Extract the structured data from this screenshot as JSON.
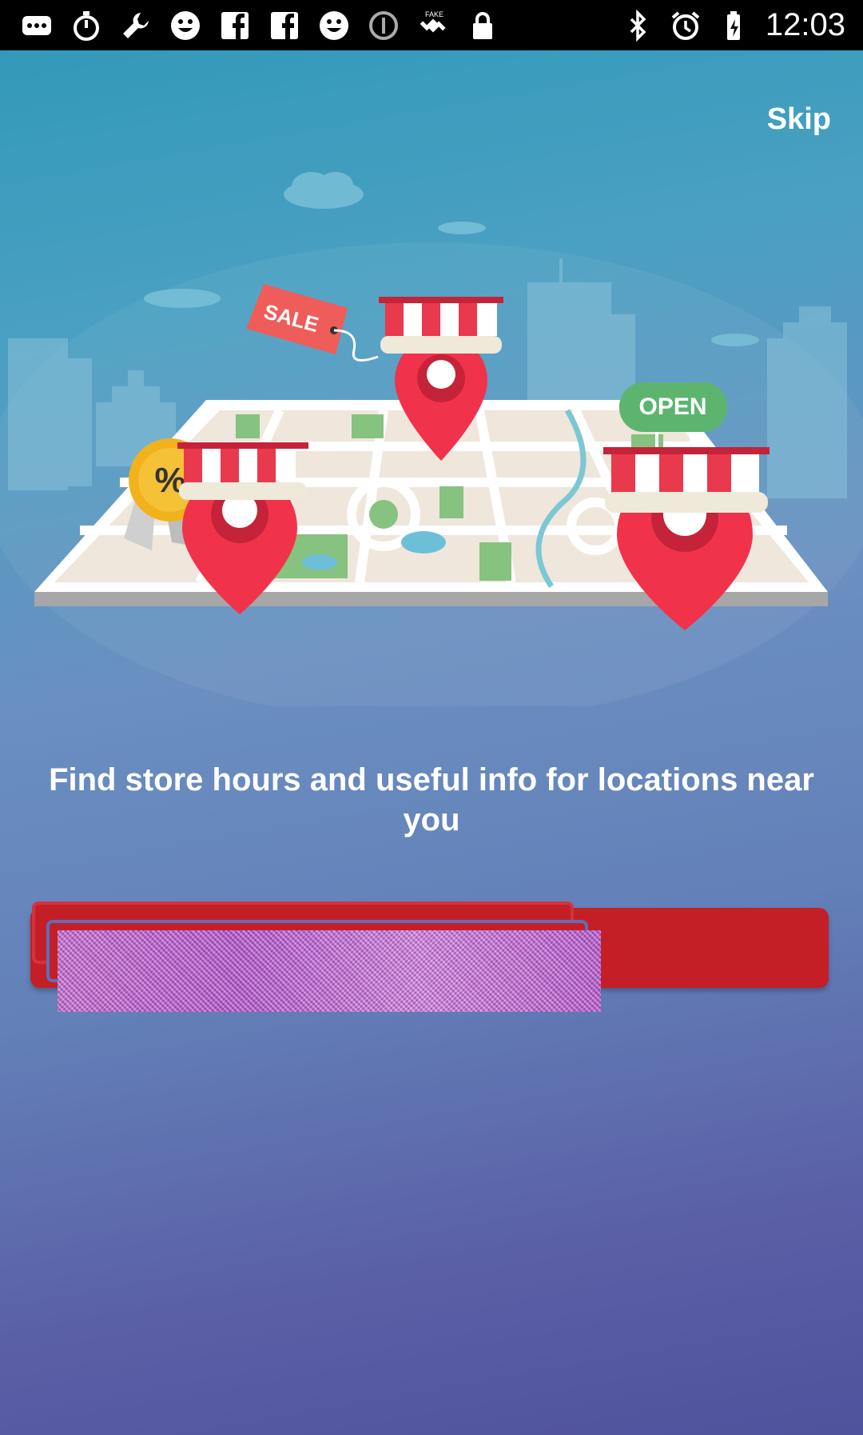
{
  "status_bar": {
    "time": "12:03",
    "left_icons": [
      "chat-bubble-icon",
      "stopwatch-icon",
      "wrench-icon",
      "smiley-icon",
      "facebook-icon",
      "facebook-icon",
      "smiley-icon",
      "info-icon",
      "fake-gps-icon",
      "lock-icon"
    ],
    "right_icons": [
      "bluetooth-icon",
      "alarm-icon",
      "battery-charging-icon"
    ]
  },
  "onboarding": {
    "skip_label": "Skip",
    "headline": "Find store hours and useful info for locations near you",
    "illustration": {
      "sale_tag": "SALE",
      "open_sign": "OPEN",
      "discount_badge": "%"
    },
    "cta_label": ""
  },
  "colors": {
    "accent_red": "#c41f27",
    "pin_red": "#f0334b",
    "open_green": "#5db46f",
    "badge_yellow": "#f2b21c"
  }
}
